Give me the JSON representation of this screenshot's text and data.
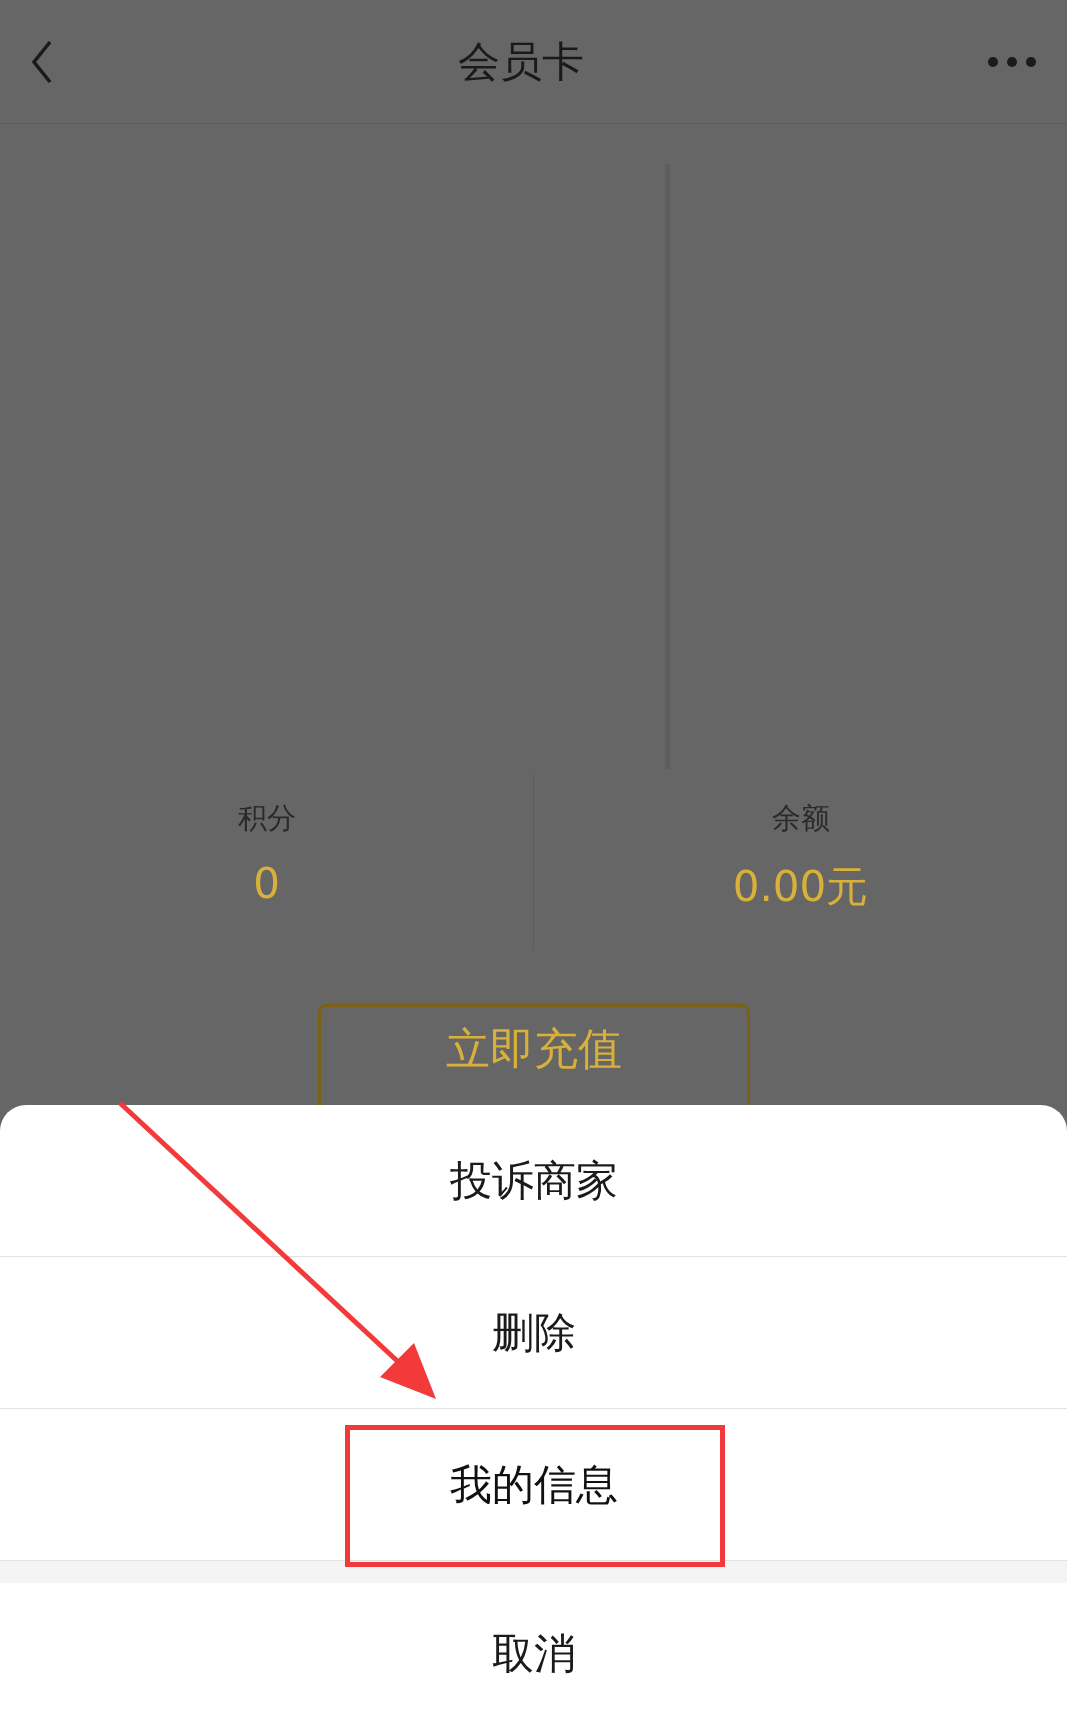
{
  "nav": {
    "title": "会员卡"
  },
  "stats": [
    {
      "label": "积分",
      "value": "0"
    },
    {
      "label": "余额",
      "value": "0.00元"
    }
  ],
  "recharge_button": {
    "label": "立即充值"
  },
  "action_sheet": {
    "items": [
      {
        "label": "投诉商家",
        "highlighted": false
      },
      {
        "label": "删除",
        "highlighted": false
      },
      {
        "label": "我的信息",
        "highlighted": true
      }
    ],
    "cancel": "取消"
  }
}
